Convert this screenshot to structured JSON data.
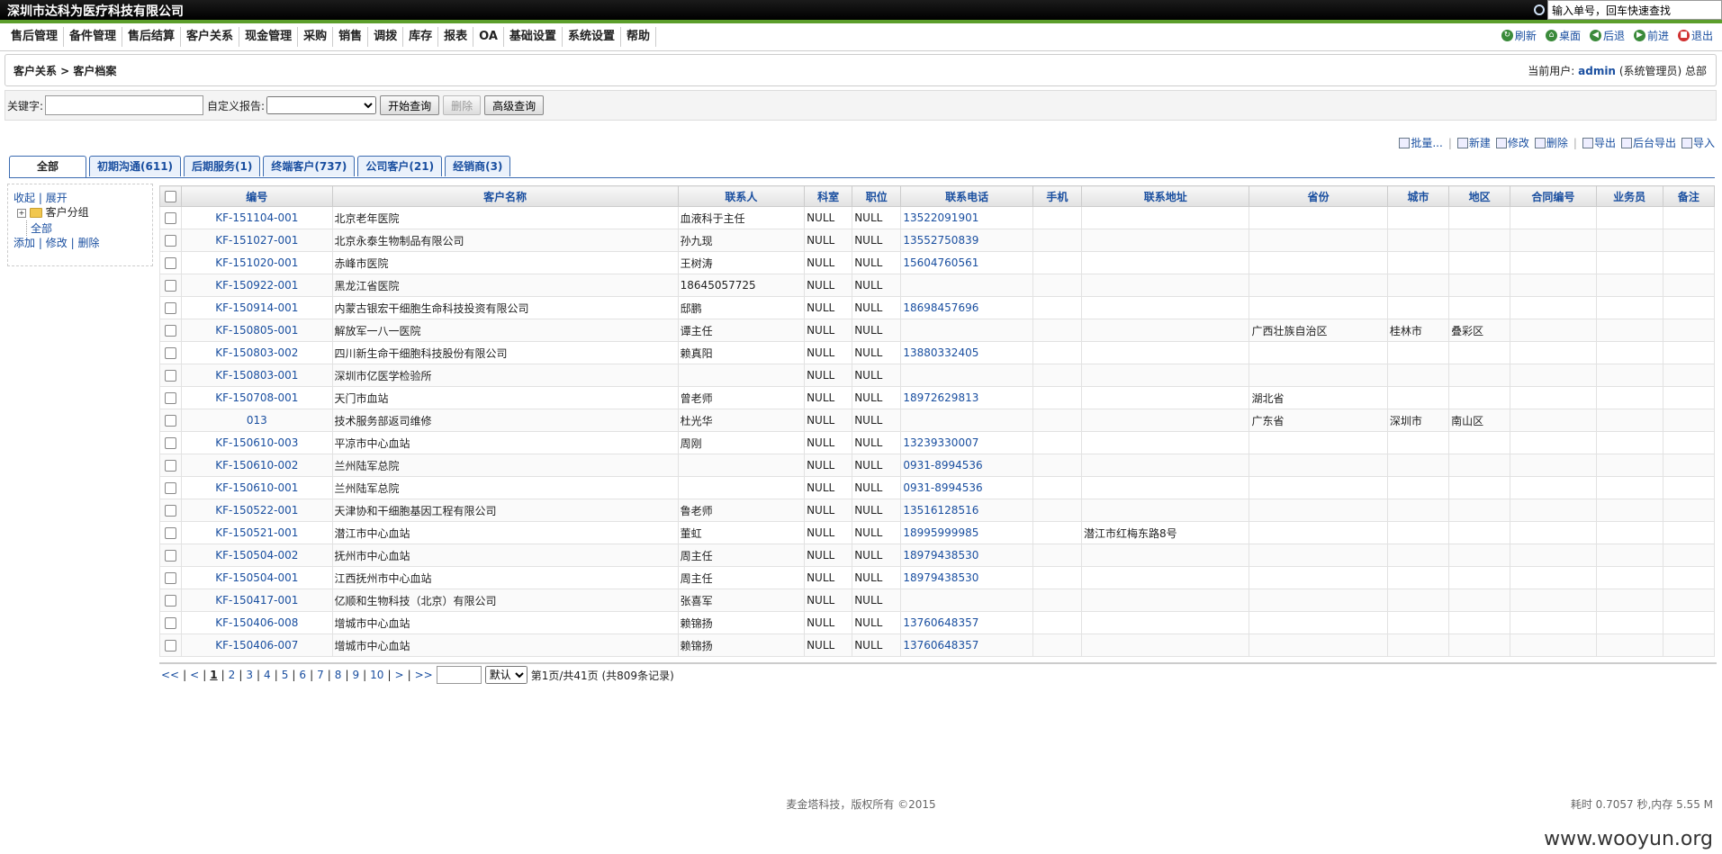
{
  "app_title": "深圳市达科为医疗科技有限公司",
  "quick_search": {
    "placeholder": "输入单号，回车快速查找"
  },
  "menu": [
    "售后管理",
    "备件管理",
    "售后结算",
    "客户关系",
    "现金管理",
    "采购",
    "销售",
    "调拨",
    "库存",
    "报表",
    "OA",
    "基础设置",
    "系统设置",
    "帮助"
  ],
  "tools": [
    {
      "label": "刷新",
      "icon": "refresh-icon",
      "color": "#3a8a3a"
    },
    {
      "label": "桌面",
      "icon": "home-icon",
      "color": "#3a8a3a"
    },
    {
      "label": "后退",
      "icon": "back-icon",
      "color": "#3a8a3a"
    },
    {
      "label": "前进",
      "icon": "forward-icon",
      "color": "#3a8a3a"
    },
    {
      "label": "退出",
      "icon": "exit-icon",
      "color": "#d03030"
    }
  ],
  "breadcrumb": "客户关系 > 客户档案",
  "user": {
    "prefix": "当前用户:",
    "name": "admin",
    "suffix": "(系统管理员) 总部"
  },
  "search": {
    "keyword_label": "关键字:",
    "report_label": "自定义报告:",
    "start": "开始查询",
    "delete": "删除",
    "advanced": "高级查询"
  },
  "actions": [
    "批量...",
    "新建",
    "修改",
    "删除",
    "导出",
    "后台导出",
    "导入"
  ],
  "tabs": [
    "全部",
    "初期沟通(611)",
    "后期服务(1)",
    "终端客户(737)",
    "公司客户(21)",
    "经销商(3)"
  ],
  "tree": {
    "collapse": "收起",
    "expand": "展开",
    "group": "客户分组",
    "all": "全部",
    "add": "添加",
    "edit": "修改",
    "del": "删除"
  },
  "columns": [
    "编号",
    "客户名称",
    "联系人",
    "科室",
    "职位",
    "联系电话",
    "手机",
    "联系地址",
    "省份",
    "城市",
    "地区",
    "合同编号",
    "业务员",
    "备注"
  ],
  "rows": [
    [
      "KF-151104-001",
      "北京老年医院",
      "血液科于主任",
      "NULL",
      "NULL",
      "13522091901",
      "",
      "",
      "",
      "",
      "",
      "",
      "",
      ""
    ],
    [
      "KF-151027-001",
      "北京永泰生物制品有限公司",
      "孙九现",
      "NULL",
      "NULL",
      "13552750839",
      "",
      "",
      "",
      "",
      "",
      "",
      "",
      ""
    ],
    [
      "KF-151020-001",
      "赤峰市医院",
      "王树涛",
      "NULL",
      "NULL",
      "15604760561",
      "",
      "",
      "",
      "",
      "",
      "",
      "",
      ""
    ],
    [
      "KF-150922-001",
      "黑龙江省医院",
      "18645057725",
      "NULL",
      "NULL",
      "",
      "",
      "",
      "",
      "",
      "",
      "",
      "",
      ""
    ],
    [
      "KF-150914-001",
      "内蒙古银宏干细胞生命科技投资有限公司",
      "邸鹏",
      "NULL",
      "NULL",
      "18698457696",
      "",
      "",
      "",
      "",
      "",
      "",
      "",
      ""
    ],
    [
      "KF-150805-001",
      "解放军一八一医院",
      "谭主任",
      "NULL",
      "NULL",
      "",
      "",
      "",
      "广西壮族自治区",
      "桂林市",
      "叠彩区",
      "",
      "",
      ""
    ],
    [
      "KF-150803-002",
      "四川新生命干细胞科技股份有限公司",
      "赖真阳",
      "NULL",
      "NULL",
      "13880332405",
      "",
      "",
      "",
      "",
      "",
      "",
      "",
      ""
    ],
    [
      "KF-150803-001",
      "深圳市亿医学检验所",
      "",
      "NULL",
      "NULL",
      "",
      "",
      "",
      "",
      "",
      "",
      "",
      "",
      ""
    ],
    [
      "KF-150708-001",
      "天门市血站",
      "曾老师",
      "NULL",
      "NULL",
      "18972629813",
      "",
      "",
      "湖北省",
      "",
      "",
      "",
      "",
      ""
    ],
    [
      "013",
      "技术服务部返司维修",
      "杜光华",
      "NULL",
      "NULL",
      "",
      "",
      "",
      "广东省",
      "深圳市",
      "南山区",
      "",
      "",
      ""
    ],
    [
      "KF-150610-003",
      "平凉市中心血站",
      "周刚",
      "NULL",
      "NULL",
      "13239330007",
      "",
      "",
      "",
      "",
      "",
      "",
      "",
      ""
    ],
    [
      "KF-150610-002",
      "兰州陆军总院",
      "",
      "NULL",
      "NULL",
      "0931-8994536",
      "",
      "",
      "",
      "",
      "",
      "",
      "",
      ""
    ],
    [
      "KF-150610-001",
      "兰州陆军总院",
      "",
      "NULL",
      "NULL",
      "0931-8994536",
      "",
      "",
      "",
      "",
      "",
      "",
      "",
      ""
    ],
    [
      "KF-150522-001",
      "天津协和干细胞基因工程有限公司",
      "鲁老师",
      "NULL",
      "NULL",
      "13516128516",
      "",
      "",
      "",
      "",
      "",
      "",
      "",
      ""
    ],
    [
      "KF-150521-001",
      "潜江市中心血站",
      "董虹",
      "NULL",
      "NULL",
      "18995999985",
      "",
      "潜江市红梅东路8号",
      "",
      "",
      "",
      "",
      "",
      ""
    ],
    [
      "KF-150504-002",
      "抚州市中心血站",
      "周主任",
      "NULL",
      "NULL",
      "18979438530",
      "",
      "",
      "",
      "",
      "",
      "",
      "",
      ""
    ],
    [
      "KF-150504-001",
      "江西抚州市中心血站",
      "周主任",
      "NULL",
      "NULL",
      "18979438530",
      "",
      "",
      "",
      "",
      "",
      "",
      "",
      ""
    ],
    [
      "KF-150417-001",
      "亿顺和生物科技（北京）有限公司",
      "张喜军",
      "NULL",
      "NULL",
      "",
      "",
      "",
      "",
      "",
      "",
      "",
      "",
      ""
    ],
    [
      "KF-150406-008",
      "增城市中心血站",
      "赖锦扬",
      "NULL",
      "NULL",
      "13760648357",
      "",
      "",
      "",
      "",
      "",
      "",
      "",
      ""
    ],
    [
      "KF-150406-007",
      "增城市中心血站",
      "赖锦扬",
      "NULL",
      "NULL",
      "13760648357",
      "",
      "",
      "",
      "",
      "",
      "",
      "",
      ""
    ]
  ],
  "pager": {
    "links": [
      "<<",
      "<",
      "1",
      "2",
      "3",
      "4",
      "5",
      "6",
      "7",
      "8",
      "9",
      "10",
      ">",
      ">>"
    ],
    "current": "1",
    "sort": "默认",
    "summary": "第1页/共41页 (共809条记录)"
  },
  "footer": "麦金塔科技，版权所有 ©2015",
  "perf": "耗时 0.7057 秒,内存 5.55 M",
  "watermark": "www.wooyun.org"
}
